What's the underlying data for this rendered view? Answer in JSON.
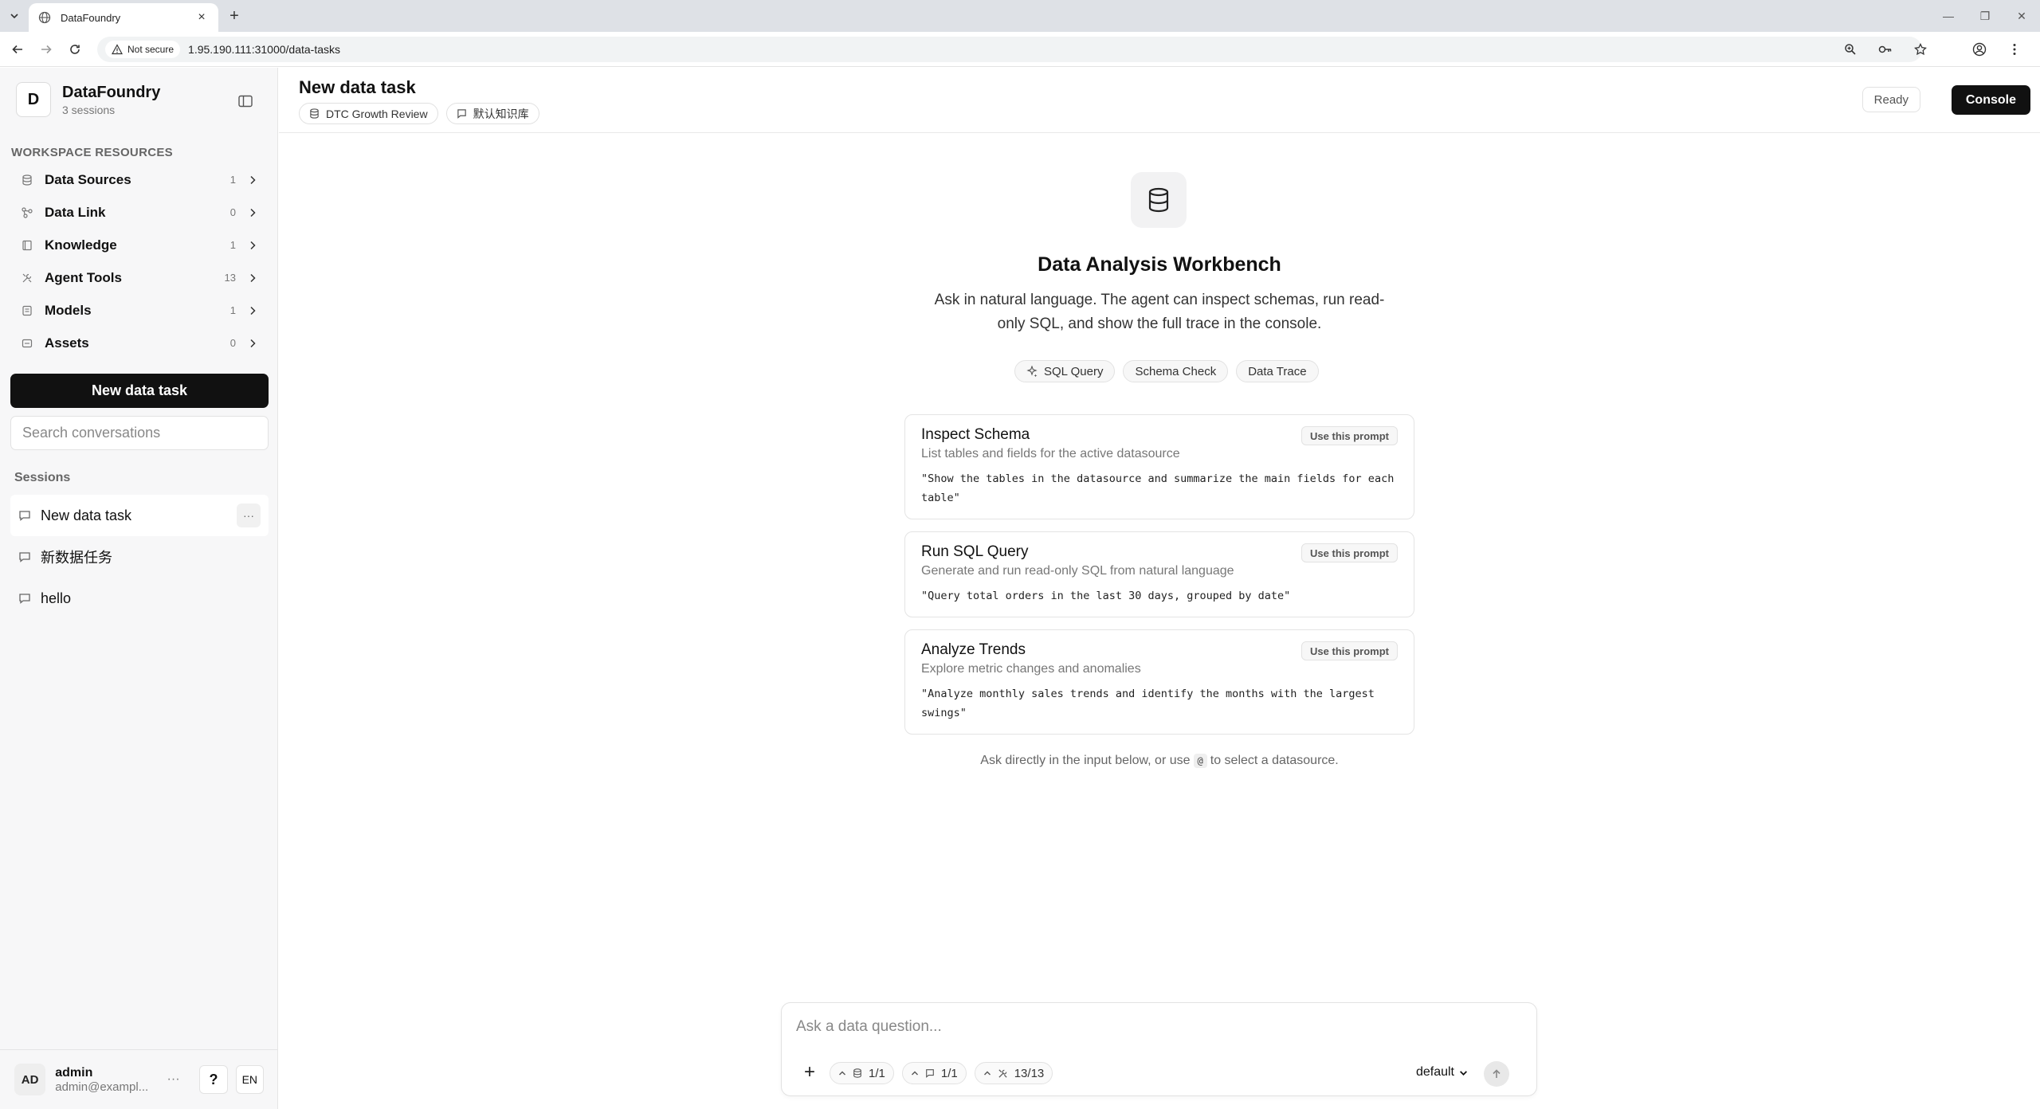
{
  "browser": {
    "tab_title": "DataFoundry",
    "not_secure_label": "Not secure",
    "url": "1.95.190.111:31000/data-tasks"
  },
  "sidebar": {
    "brand_initial": "D",
    "brand_name": "DataFoundry",
    "brand_sub": "3 sessions",
    "resources_title": "WORKSPACE RESOURCES",
    "resources": [
      {
        "label": "Data Sources",
        "count": "1"
      },
      {
        "label": "Data Link",
        "count": "0"
      },
      {
        "label": "Knowledge",
        "count": "1"
      },
      {
        "label": "Agent Tools",
        "count": "13"
      },
      {
        "label": "Models",
        "count": "1"
      },
      {
        "label": "Assets",
        "count": "0"
      }
    ],
    "new_task_label": "New data task",
    "search_placeholder": "Search conversations",
    "sessions_title": "Sessions",
    "sessions": [
      {
        "label": "New data task"
      },
      {
        "label": "新数据任务"
      },
      {
        "label": "hello"
      }
    ],
    "session_more": "···",
    "user": {
      "initials": "AD",
      "name": "admin",
      "email": "admin@exampl...",
      "more": "···",
      "help": "?",
      "lang": "EN"
    }
  },
  "header": {
    "title": "New data task",
    "chips": [
      {
        "label": "DTC Growth Review",
        "icon": "database-icon"
      },
      {
        "label": "默认知识库",
        "icon": "book-icon"
      }
    ],
    "status": "Ready",
    "console_label": "Console"
  },
  "hero": {
    "title": "Data Analysis Workbench",
    "description": "Ask in natural language. The agent can inspect schemas, run read-only SQL, and show the full trace in the console.",
    "tags": [
      "SQL Query",
      "Schema Check",
      "Data Trace"
    ]
  },
  "prompts": [
    {
      "title": "Inspect Schema",
      "subtitle": "List tables and fields for the active datasource",
      "prompt": "\"Show the tables in the datasource and summarize the main fields for each table\"",
      "button": "Use this prompt"
    },
    {
      "title": "Run SQL Query",
      "subtitle": "Generate and run read-only SQL from natural language",
      "prompt": "\"Query total orders in the last 30 days, grouped by date\"",
      "button": "Use this prompt"
    },
    {
      "title": "Analyze Trends",
      "subtitle": "Explore metric changes and anomalies",
      "prompt": "\"Analyze monthly sales trends and identify the months with the largest swings\"",
      "button": "Use this prompt"
    }
  ],
  "hint": {
    "before": "Ask directly in the input below, or use",
    "key": "@",
    "after": "to select a datasource."
  },
  "composer": {
    "placeholder": "Ask a data question...",
    "datasource_count": "1/1",
    "knowledge_count": "1/1",
    "tools_count": "13/13",
    "model": "default"
  },
  "colors": {
    "primary_button": "#111111",
    "sidebar_bg": "#f7f7f8"
  }
}
